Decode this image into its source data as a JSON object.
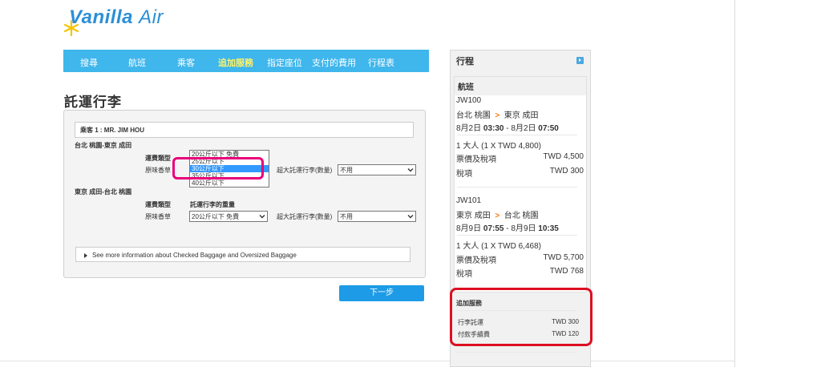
{
  "brand": {
    "name_main": "Vanilla",
    "name_sub": "Air",
    "brand_color": "#2c8fd6"
  },
  "nav": {
    "items": [
      {
        "label": "搜尋"
      },
      {
        "label": "航班"
      },
      {
        "label": "乘客"
      },
      {
        "label": "追加服務",
        "active": true
      },
      {
        "label": "指定座位"
      },
      {
        "label": "支付的費用"
      },
      {
        "label": "行程表"
      }
    ],
    "bar_color": "#3fb6ec",
    "active_color": "#fff36a"
  },
  "page": {
    "title": "託運行李"
  },
  "form": {
    "passenger": "乘客 1 : MR. JIM HOU",
    "segments": [
      {
        "route": "台北 桃園-東京 成田",
        "fare_type_label": "運費類型",
        "fare_type_value": "原味香草",
        "baggage_dropdown_options": [
          "20公斤以下 免費",
          "25公斤以下",
          "30公斤以下",
          "35公斤以下",
          "40公斤以下"
        ],
        "baggage_highlighted": "30公斤以下",
        "oversized_label": "超大託運行李(數量)",
        "oversized_value": "不用"
      },
      {
        "route": "東京 成田-台北 桃園",
        "fare_type_label": "運費類型",
        "fare_type_value": "原味香草",
        "baggage_label": "託運行李的重量",
        "baggage_value": "20公斤以下 免費",
        "oversized_label": "超大託運行李(數量)",
        "oversized_value": "不用"
      }
    ],
    "more_info": "See more information about Checked Baggage and Oversized Baggage"
  },
  "next_button": "下一步",
  "itinerary": {
    "title": "行程",
    "flights_header": "航班",
    "flights": [
      {
        "number": "JW100",
        "from": "台北 桃園",
        "to": "東京 成田",
        "dep_date": "8月2日",
        "dep_time": "03:30",
        "arr_date": "8月2日",
        "arr_time": "07:50",
        "pax": "1 大人 (1 X TWD 4,800)",
        "fare_label": "票價及稅項",
        "fare_value": "TWD 4,500",
        "tax_label": "稅項",
        "tax_value": "TWD 300"
      },
      {
        "number": "JW101",
        "from": "東京 成田",
        "to": "台北 桃園",
        "dep_date": "8月9日",
        "dep_time": "07:55",
        "arr_date": "8月9日",
        "arr_time": "10:35",
        "pax": "1 大人 (1 X TWD 6,468)",
        "fare_label": "票價及稅項",
        "fare_value": "TWD 5,700",
        "tax_label": "稅項",
        "tax_value": "TWD 768"
      }
    ],
    "services_header": "追加服務",
    "services": [
      {
        "label": "行李託運",
        "value": "TWD 300"
      },
      {
        "label": "付款手續費",
        "value": "TWD 120"
      }
    ]
  },
  "annotations": {
    "ring_pink": "#e8007a",
    "ring_red": "#dc0f21"
  }
}
